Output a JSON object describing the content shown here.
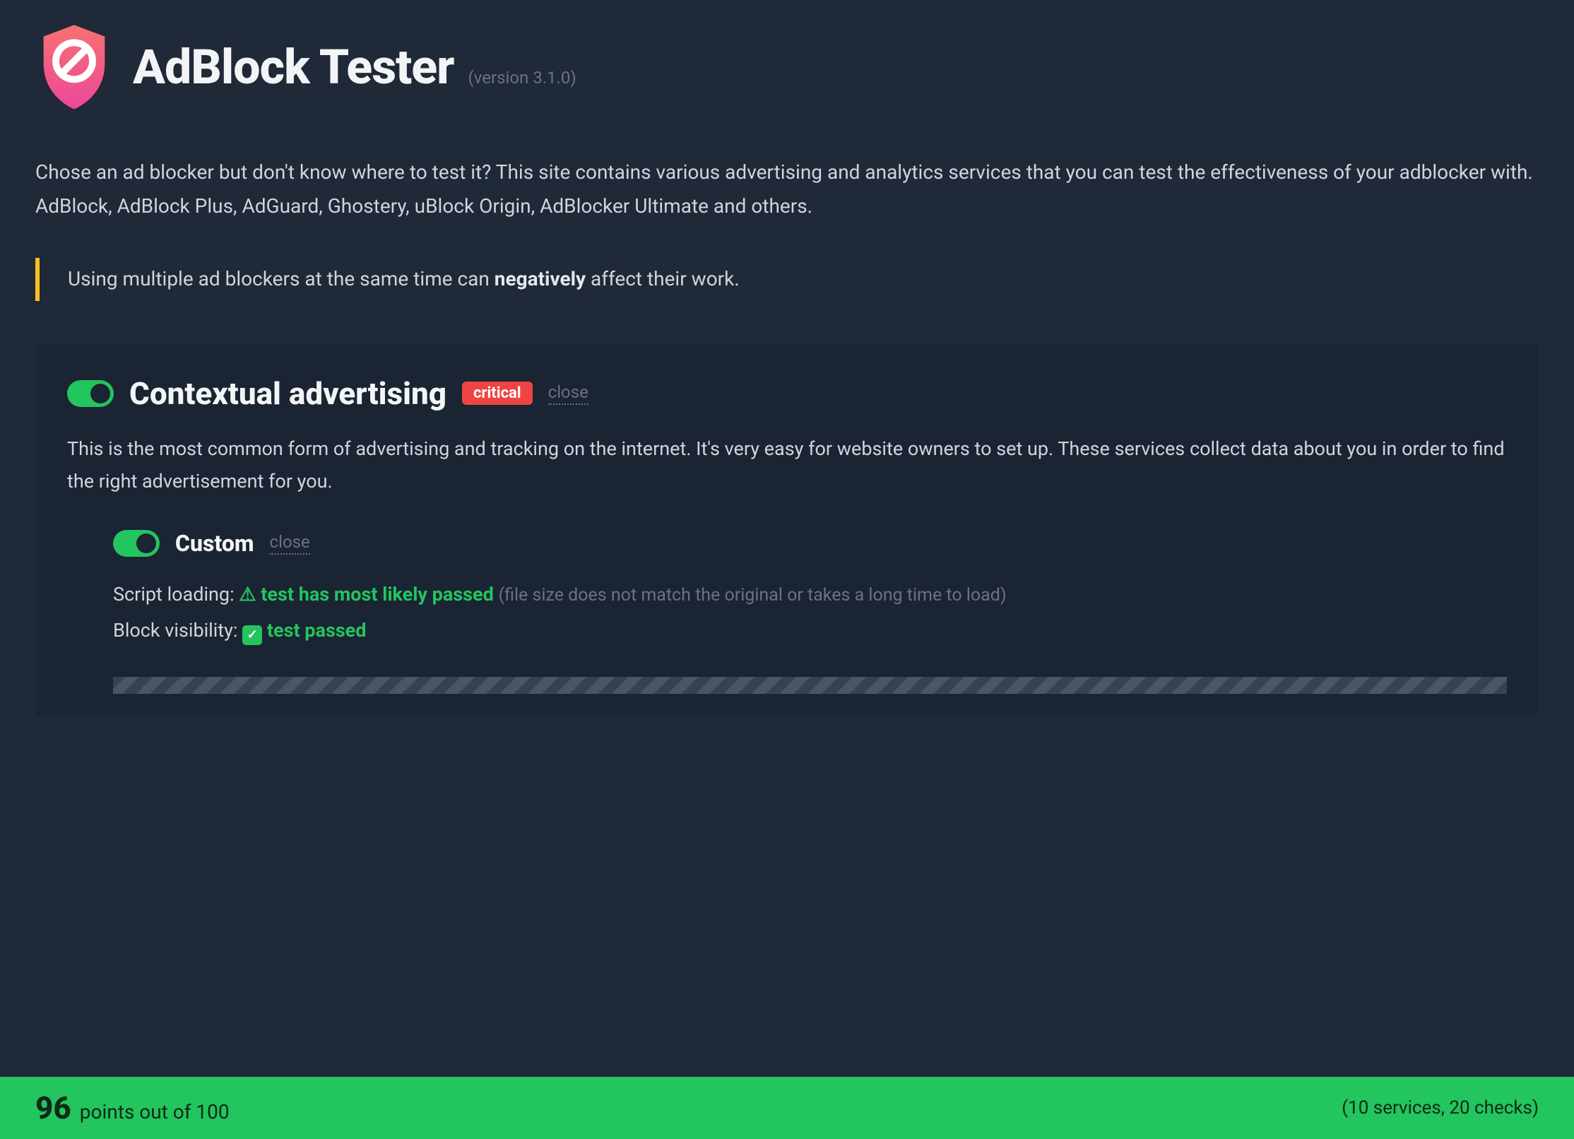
{
  "header": {
    "title": "AdBlock Tester",
    "version": "(version 3.1.0)"
  },
  "intro": {
    "line1": "Chose an ad blocker but don't know where to test it? This site contains various advertising and analytics services that you can test the effectiveness of your adblocker with.",
    "line2": "AdBlock, AdBlock Plus, AdGuard, Ghostery, uBlock Origin, AdBlocker Ultimate and others."
  },
  "callout": {
    "prefix": "Using multiple ad blockers at the same time can ",
    "strong": "negatively",
    "suffix": " affect their work."
  },
  "section": {
    "title": "Contextual advertising",
    "badge": "critical",
    "close": "close",
    "description": "This is the most common form of advertising and tracking on the internet. It's very easy for website owners to set up. These services collect data about you in order to find the right advertisement for you."
  },
  "subsection": {
    "title": "Custom",
    "close": "close",
    "tests": {
      "script_loading": {
        "label": "Script loading:",
        "result": "test has most likely passed",
        "note": "(file size does not match the original or takes a long time to load)"
      },
      "block_visibility": {
        "label": "Block visibility:",
        "result": "test passed"
      }
    }
  },
  "score": {
    "value": "96",
    "label": "points out of 100",
    "summary": "(10 services, 20 checks)"
  }
}
